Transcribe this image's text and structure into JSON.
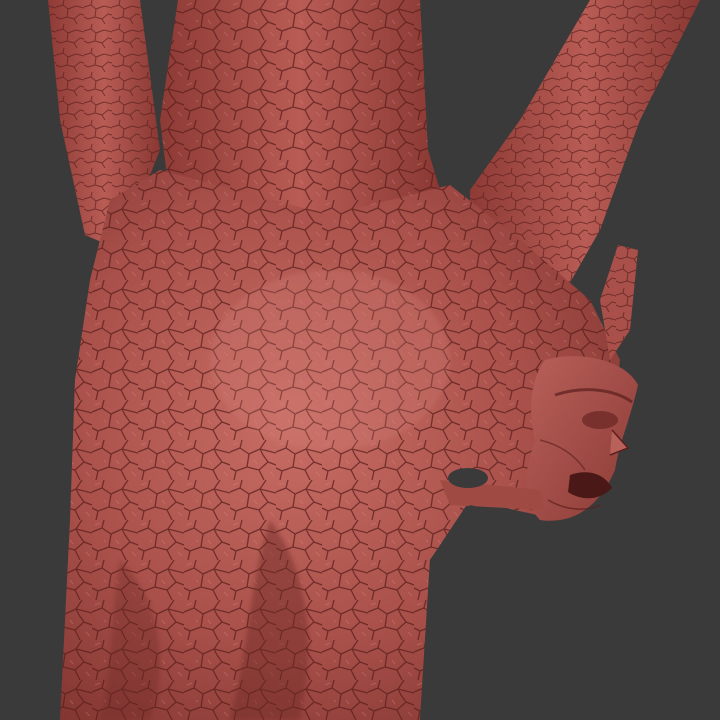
{
  "scene": {
    "background_color": "#3a3a3a",
    "model_base_color": "#b0524a",
    "model_highlight_color": "#c9706a",
    "model_shadow_color": "#6e2a27",
    "crack_color": "#5a1f1c",
    "subject": "sculpted-tree-trunk-with-face"
  }
}
